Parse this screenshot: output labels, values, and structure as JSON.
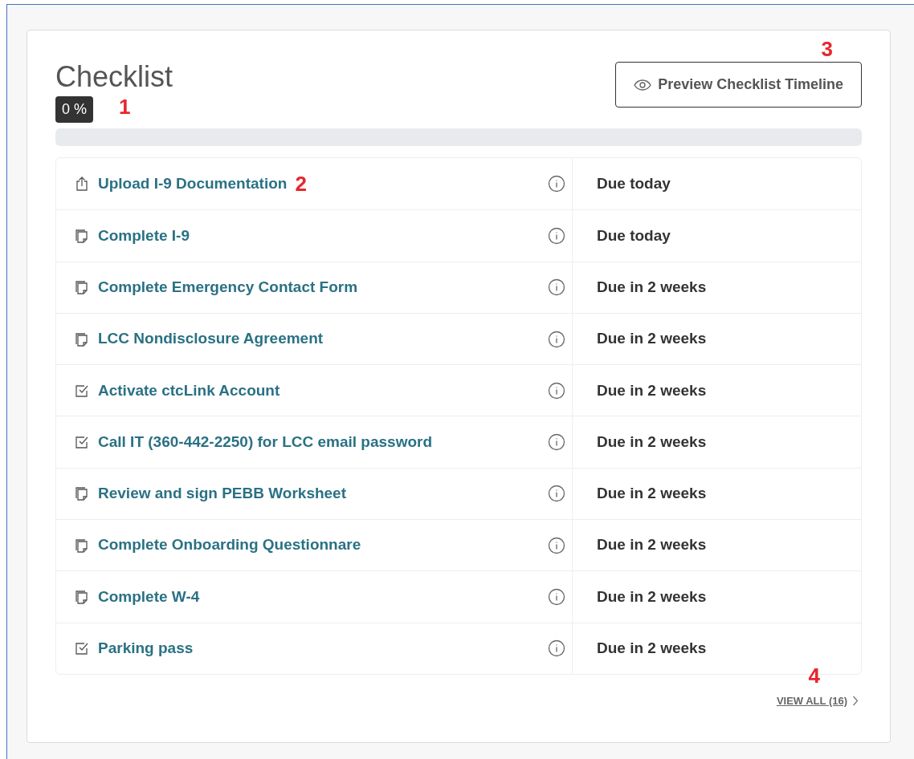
{
  "title": "Checklist",
  "progress": {
    "label": "0 %",
    "level": 0
  },
  "preview_button": {
    "label": "Preview Checklist Timeline"
  },
  "tasks": [
    {
      "kind": "upload",
      "name": "Upload I-9 Documentation",
      "due": "Due today"
    },
    {
      "kind": "form",
      "name": "Complete I-9",
      "due": "Due today"
    },
    {
      "kind": "form",
      "name": "Complete Emergency Contact Form",
      "due": "Due in 2 weeks"
    },
    {
      "kind": "form",
      "name": "LCC Nondisclosure Agreement",
      "due": "Due in 2 weeks"
    },
    {
      "kind": "task",
      "name": "Activate ctcLink Account",
      "due": "Due in 2 weeks"
    },
    {
      "kind": "task",
      "name": "Call IT (360-442-2250) for LCC email password",
      "due": "Due in 2 weeks"
    },
    {
      "kind": "form",
      "name": "Review and sign PEBB Worksheet",
      "due": "Due in 2 weeks"
    },
    {
      "kind": "form",
      "name": "Complete Onboarding Questionnare",
      "due": "Due in 2 weeks"
    },
    {
      "kind": "form",
      "name": "Complete W-4",
      "due": "Due in 2 weeks"
    },
    {
      "kind": "task",
      "name": "Parking pass",
      "due": "Due in 2 weeks"
    }
  ],
  "view_all": {
    "label": "VIEW ALL (16)"
  },
  "callouts": [
    "1",
    "2",
    "3",
    "4"
  ]
}
